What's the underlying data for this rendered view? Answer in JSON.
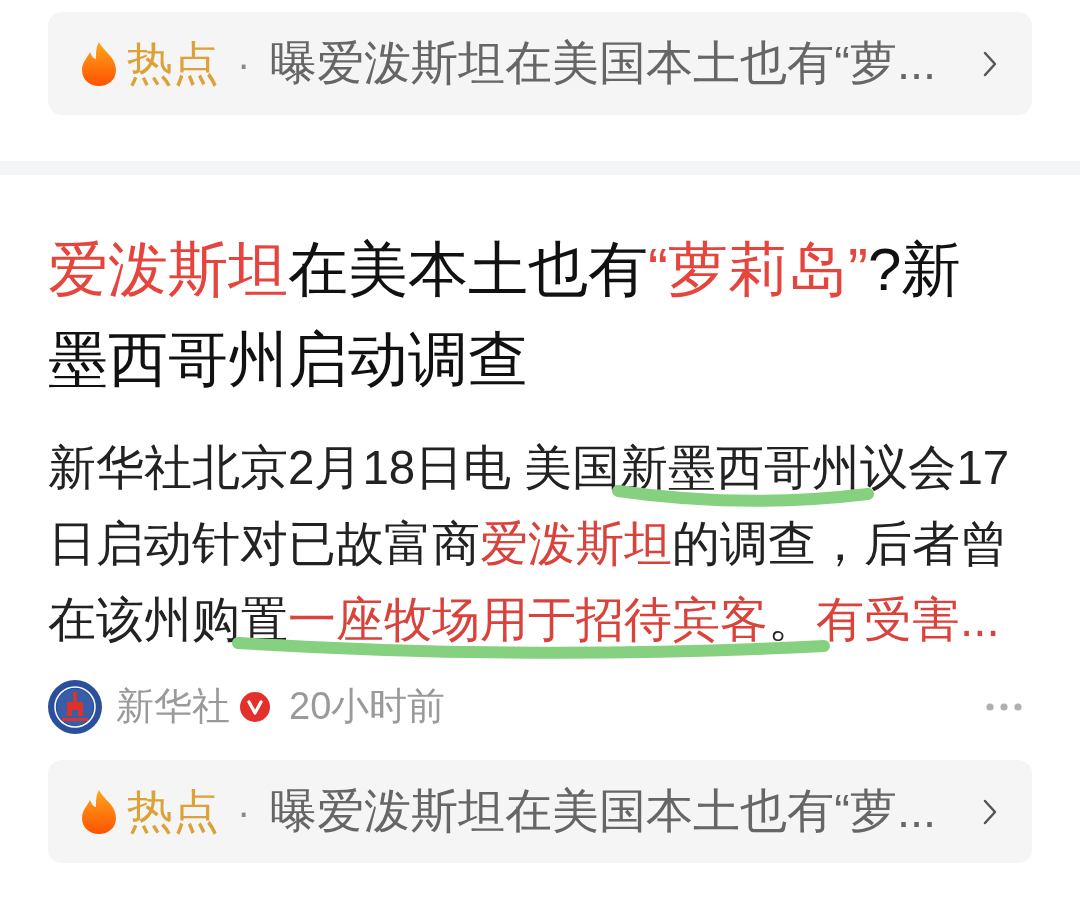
{
  "top_hot_bar": {
    "label": "热点",
    "separator": "·",
    "headline": "曝爱泼斯坦在美国本土也有“萝..."
  },
  "article": {
    "title": [
      {
        "text": "爱泼斯坦",
        "emphasized": true
      },
      {
        "text": "在美本土也有",
        "emphasized": false
      },
      {
        "text": "“萝莉岛”",
        "emphasized": true
      },
      {
        "text": "?新墨西哥州启动调查",
        "emphasized": false
      }
    ],
    "body": [
      {
        "text": "新华社北京2月18日电 美国",
        "emphasized": false,
        "highlighted": false
      },
      {
        "text": "新墨西哥州",
        "emphasized": false,
        "highlighted": true
      },
      {
        "text": "议会17日启动针对已故富商",
        "emphasized": false,
        "highlighted": false
      },
      {
        "text": "爱泼斯坦",
        "emphasized": true,
        "highlighted": false
      },
      {
        "text": "的调查，后者曾在该州购",
        "emphasized": false,
        "highlighted": false
      },
      {
        "text": "置",
        "emphasized": false,
        "highlighted": true
      },
      {
        "text": "一座牧场用于招待宾客",
        "emphasized": true,
        "highlighted": true
      },
      {
        "text": "。",
        "emphasized": false,
        "highlighted": true
      },
      {
        "text": "有受害...",
        "emphasized": true,
        "highlighted": false
      }
    ],
    "source": {
      "name": "新华社",
      "verified": true,
      "time": "20小时前"
    }
  },
  "bottom_hot_bar": {
    "label": "热点",
    "separator": "·",
    "headline": "曝爱泼斯坦在美国本土也有“萝..."
  }
}
